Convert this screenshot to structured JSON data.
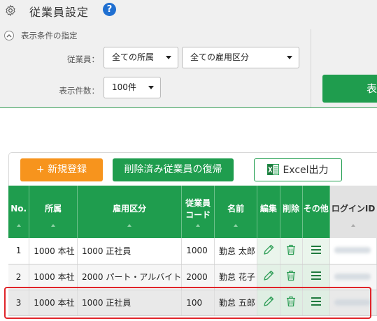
{
  "header": {
    "title": "従業員設定",
    "help": "?"
  },
  "filter": {
    "heading": "表示条件の指定",
    "employee_label": "従業員：",
    "dept_select": "全ての所属",
    "emptype_select": "全ての雇用区分",
    "count_label": "表示件数：",
    "count_select": "100件",
    "display_button": "表"
  },
  "toolbar": {
    "new_button": "+ 新規登録",
    "restore_button": "削除済み従業員の復帰",
    "excel_button": "Excel出力"
  },
  "table": {
    "headers": {
      "no": "No.",
      "dept": "所属",
      "emptype": "雇用区分",
      "code_line1": "従業員",
      "code_line2": "コード",
      "name": "名前",
      "edit": "編集",
      "delete": "削除",
      "other": "その他",
      "login": "ログインID"
    },
    "rows": [
      {
        "no": "1",
        "dept": "1000 本社",
        "emptype": "1000 正社員",
        "code": "1000",
        "name": "勤怠 太郎"
      },
      {
        "no": "2",
        "dept": "1000 本社",
        "emptype": "2000 パート・アルバイト",
        "code": "2000",
        "name": "勤怠 花子"
      },
      {
        "no": "3",
        "dept": "1000 本社",
        "emptype": "1000 正社員",
        "code": "100",
        "name": "勤怠 五郎"
      }
    ]
  },
  "colors": {
    "green": "#1f9d4e",
    "orange": "#f7941d",
    "highlight": "#e0242a",
    "help_blue": "#1f6fd1"
  },
  "icons": [
    "gear-icon",
    "help-icon",
    "collapse-icon",
    "excel-icon",
    "pencil-icon",
    "trash-icon",
    "menu-icon"
  ]
}
